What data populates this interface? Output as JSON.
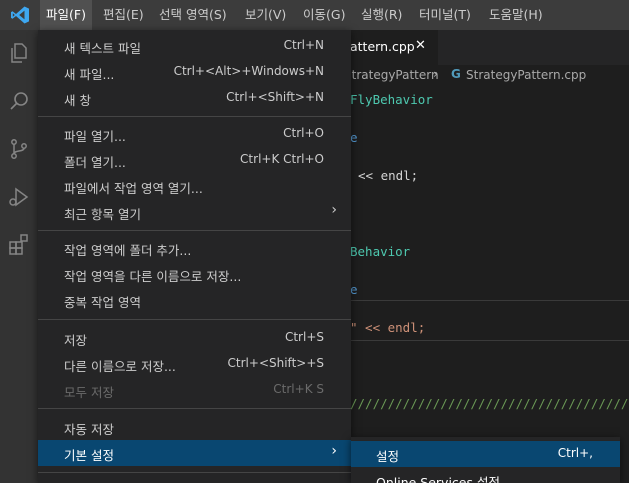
{
  "menubar": {
    "items": [
      "파일(F)",
      "편집(E)",
      "선택 영역(S)",
      "보기(V)",
      "이동(G)",
      "실행(R)",
      "터미널(T)",
      "도움말(H)"
    ],
    "active_index": 0
  },
  "activitybar": {
    "icons": [
      "explorer-icon",
      "search-icon",
      "source-control-icon",
      "run-debug-icon",
      "extensions-icon"
    ]
  },
  "editor": {
    "tab": {
      "label": "attern.cpp",
      "close": "✕"
    },
    "breadcrumb": {
      "folder": "StrategyPattern",
      "separator": "›",
      "file_icon": "G",
      "file": "StrategyPattern.cpp"
    },
    "code_lines": [
      "FlyBehavior",
      "e",
      "<< endl;",
      "Behavior",
      "e",
      "\" << endl;",
      "/////////////////////////////////////////"
    ]
  },
  "file_menu": {
    "items": [
      {
        "label": "새 텍스트 파일",
        "shortcut": "Ctrl+N"
      },
      {
        "label": "새 파일...",
        "shortcut": "Ctrl+<Alt>+Windows+N"
      },
      {
        "label": "새 창",
        "shortcut": "Ctrl+<Shift>+N"
      },
      {
        "label": "파일 열기...",
        "shortcut": "Ctrl+O"
      },
      {
        "label": "폴더 열기...",
        "shortcut": "Ctrl+K Ctrl+O"
      },
      {
        "label": "파일에서 작업 영역 열기...",
        "shortcut": ""
      },
      {
        "label": "최근 항목 열기",
        "shortcut": "",
        "submenu": "›"
      },
      {
        "label": "작업 영역에 폴더 추가...",
        "shortcut": ""
      },
      {
        "label": "작업 영역을 다른 이름으로 저장...",
        "shortcut": ""
      },
      {
        "label": "중복 작업 영역",
        "shortcut": ""
      },
      {
        "label": "저장",
        "shortcut": "Ctrl+S"
      },
      {
        "label": "다른 이름으로 저장...",
        "shortcut": "Ctrl+<Shift>+S"
      },
      {
        "label": "모두 저장",
        "shortcut": "Ctrl+K S",
        "disabled": true
      },
      {
        "label": "자동 저장",
        "shortcut": ""
      },
      {
        "label": "기본 설정",
        "shortcut": "",
        "submenu": "›",
        "selected": true
      }
    ]
  },
  "preferences_submenu": {
    "items": [
      {
        "label": "설정",
        "shortcut": "Ctrl+,"
      },
      {
        "label": "Online Services 설정",
        "shortcut": ""
      }
    ]
  }
}
